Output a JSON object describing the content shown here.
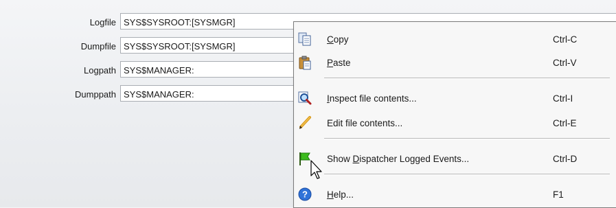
{
  "fields": [
    {
      "label": "Logfile",
      "value": "SYS$SYSROOT:[SYSMGR]"
    },
    {
      "label": "Dumpfile",
      "value": "SYS$SYSROOT:[SYSMGR]"
    },
    {
      "label": "Logpath",
      "value": "SYS$MANAGER:"
    },
    {
      "label": "Dumppath",
      "value": "SYS$MANAGER:"
    }
  ],
  "menu": {
    "copy": {
      "accel": "C",
      "rest": "opy",
      "shortcut": "Ctrl-C",
      "icon": "copy-icon"
    },
    "paste": {
      "accel": "P",
      "rest": "aste",
      "shortcut": "Ctrl-V",
      "icon": "paste-icon"
    },
    "inspect": {
      "accel": "I",
      "rest": "nspect file contents...",
      "shortcut": "Ctrl-I",
      "icon": "magnifier-icon"
    },
    "edit": {
      "text": "Edit file contents...",
      "shortcut": "Ctrl-E",
      "icon": "pencil-icon"
    },
    "show": {
      "pre": "Show ",
      "accel": "D",
      "rest": "ispatcher Logged Events...",
      "shortcut": "Ctrl-D",
      "icon": "green-flag-icon"
    },
    "help": {
      "accel": "H",
      "rest": "elp...",
      "shortcut": "F1",
      "icon": "help-icon"
    }
  }
}
